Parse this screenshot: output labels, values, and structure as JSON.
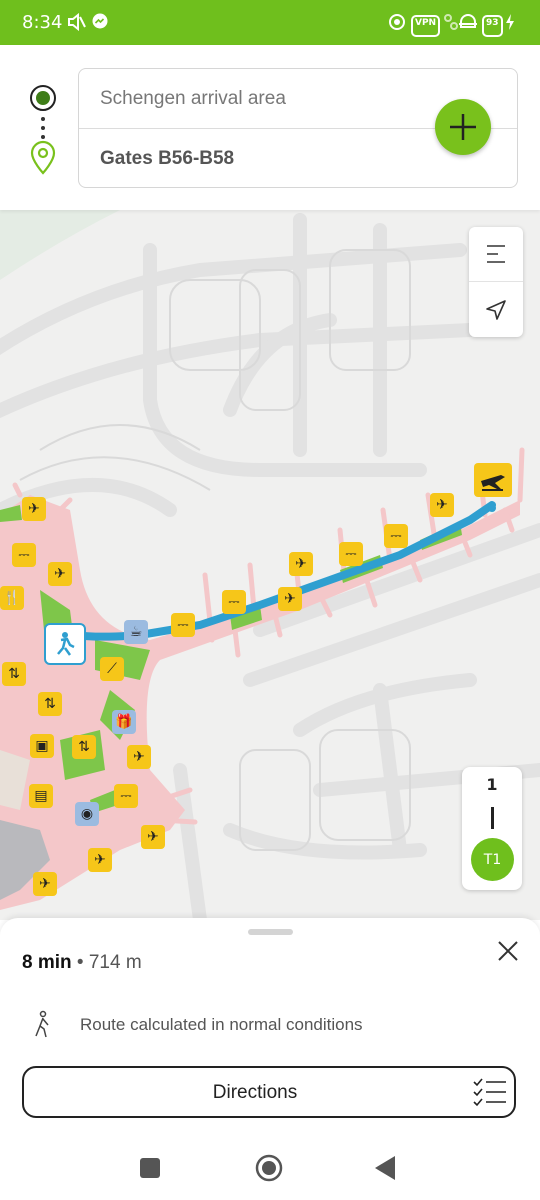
{
  "status_bar": {
    "time": "8:34",
    "vpn_label": "VPN",
    "battery": "93"
  },
  "route": {
    "origin": "Schengen arrival area",
    "destination": "Gates B56-B58"
  },
  "floor": {
    "level": "1",
    "terminal": "T1"
  },
  "summary": {
    "duration": "8 min",
    "separator": " • ",
    "distance": "714 m",
    "note": "Route calculated in normal conditions",
    "directions_label": "Directions"
  },
  "colors": {
    "brand_green": "#6fbf1d",
    "route_blue": "#2f9fd0",
    "terminal_pink": "#f5c6c8",
    "poi_yellow": "#f6c619"
  },
  "icons": {
    "origin": "origin-dot-icon",
    "destination": "location-pin-icon",
    "add": "plus-icon",
    "layers": "menu-lines-icon",
    "locate": "navigation-arrow-icon",
    "close": "close-icon",
    "walk": "walking-person-icon",
    "directions_list": "checklist-icon"
  }
}
